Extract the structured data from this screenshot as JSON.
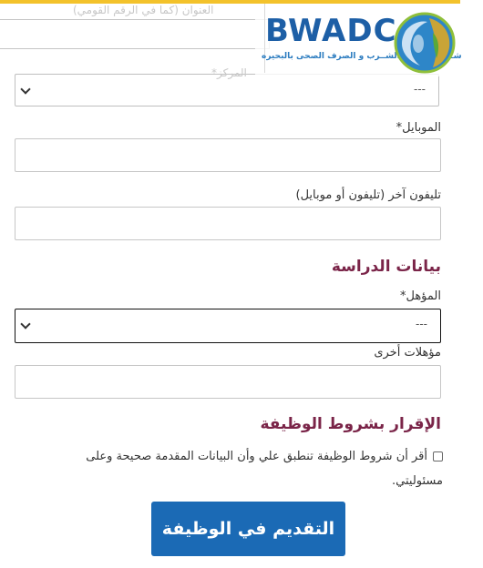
{
  "header": {
    "logo_text": "BWADC",
    "logo_subtitle": "شــركــة ميــاه الشــرب و الصرف الصحى بالبحيره",
    "ghost_field_label": "العنوان (كما في الرقم القومي)",
    "ghost_center_label": "المركز*"
  },
  "form": {
    "center_select_value": "---",
    "mobile_label": "الموبايل*",
    "other_phone_label": "تليفون آخر (تليفون أو موبايل)",
    "study_section_title": "بيانات الدراسة",
    "qualification_label": "المؤهل*",
    "qualification_select_value": "---",
    "other_qualifications_label": "مؤهلات أخرى",
    "terms_section_title": "الإقرار بشروط الوظيفة",
    "acknowledgement_text": "أقر أن شروط الوظيفة تنطبق علي وأن البيانات المقدمة صحيحة وعلى مسئوليتي.",
    "acknowledgement_checked": false,
    "submit_label": "التقديم في الوظيفة"
  },
  "colors": {
    "section_title": "#7a2448",
    "submit_button": "#1b6ab5",
    "logo_blue": "#1d5fa6",
    "top_accent": "#f3c22b"
  }
}
